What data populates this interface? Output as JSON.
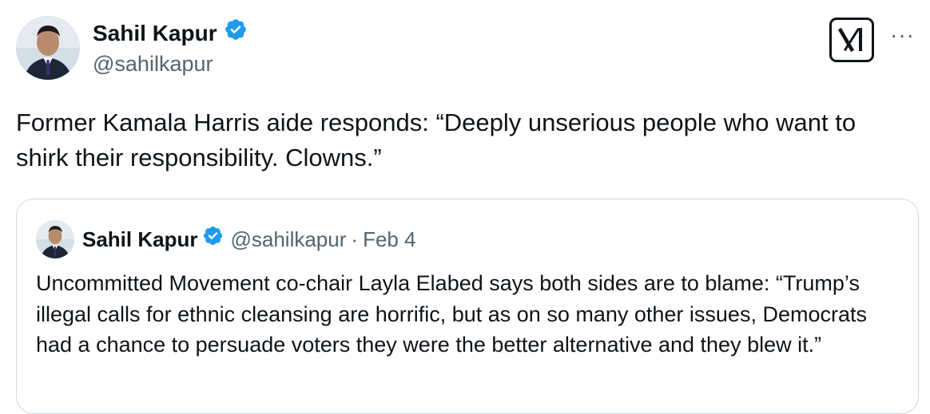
{
  "tweet": {
    "author_name": "Sahil Kapur",
    "author_handle": "@sahilkapur",
    "text": "Former Kamala Harris aide responds: “Deeply unserious people who want to shirk their responsibility. Clowns.”",
    "header_icons": {
      "logo": "x-grok-logo-icon",
      "more": "more-options-icon",
      "more_glyph": "···"
    }
  },
  "quoted_tweet": {
    "author_name": "Sahil Kapur",
    "author_handle": "@sahilkapur",
    "separator": "·",
    "date": "Feb 4",
    "text": "Uncommitted Movement co-chair Layla Elabed says both sides are to blame: “Trump’s illegal calls for ethnic cleansing are horrific, but as on so many other issues, Democrats had a chance to persuade voters they were the better alternative and they blew it.”"
  },
  "colors": {
    "text_primary": "#0f1419",
    "text_secondary": "#536471",
    "verified_blue": "#1d9bf0",
    "border": "#cfd9de"
  }
}
